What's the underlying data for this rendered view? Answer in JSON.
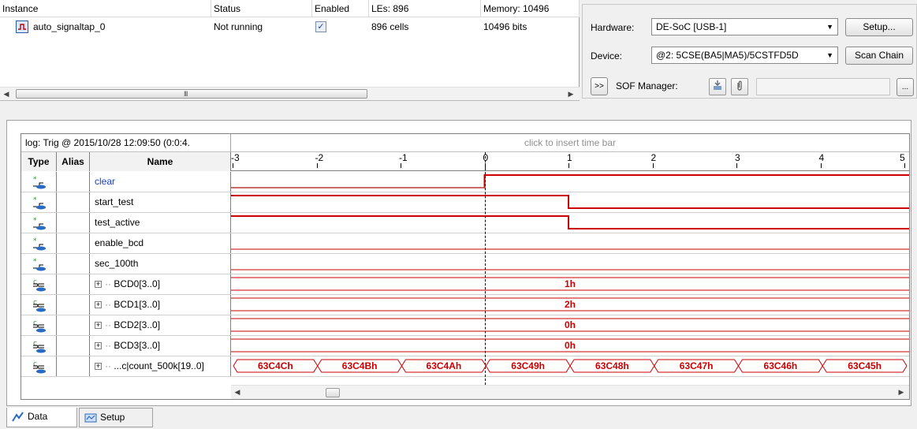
{
  "instance_manager": {
    "columns": [
      "Instance",
      "Status",
      "Enabled",
      "LEs: 896",
      "Memory: 10496"
    ],
    "row": {
      "instance": "auto_signaltap_0",
      "status": "Not running",
      "enabled": true,
      "enabled_mark": "✓",
      "les": "896 cells",
      "memory": "10496 bits"
    },
    "scroll_grip": "III",
    "scroll_left": "◀",
    "scroll_right": "▶"
  },
  "jtag": {
    "hardware_label": "Hardware:",
    "hardware_value": "DE-SoC [USB-1]",
    "setup_button": "Setup...",
    "device_label": "Device:",
    "device_value": "@2: 5CSE(BA5|MA5)/5CSTFD5D",
    "scan_chain_button": "Scan Chain",
    "expand_button": ">>",
    "sof_label": "SOF Manager:",
    "browse_button": "...",
    "dropdown_arrow": "▼"
  },
  "data_panel": {
    "log_label": "log: Trig @ 2015/10/28 12:09:50 (0:0:4.",
    "insert_hint": "click to insert time bar",
    "headers": {
      "type": "Type",
      "alias": "Alias",
      "name": "Name"
    },
    "ticks": [
      "-3",
      "-2",
      "-1",
      "0",
      "1",
      "2",
      "3",
      "4",
      "5"
    ],
    "expand_mark": "+",
    "rows": [
      {
        "name": "clear",
        "kind": "input"
      },
      {
        "name": "start_test",
        "kind": "input"
      },
      {
        "name": "test_active",
        "kind": "input"
      },
      {
        "name": "enable_bcd",
        "kind": "input"
      },
      {
        "name": "sec_100th",
        "kind": "input"
      },
      {
        "name": "BCD0[3..0]",
        "kind": "bus",
        "value": "1h"
      },
      {
        "name": "BCD1[3..0]",
        "kind": "bus",
        "value": "2h"
      },
      {
        "name": "BCD2[3..0]",
        "kind": "bus",
        "value": "0h"
      },
      {
        "name": "BCD3[3..0]",
        "kind": "bus",
        "value": "0h"
      },
      {
        "name": "...c|count_500k[19..0]",
        "kind": "bus",
        "values": [
          "63C4Ch",
          "63C4Bh",
          "63C4Ah",
          "63C49h",
          "63C48h",
          "63C47h",
          "63C46h",
          "63C45h"
        ]
      }
    ],
    "scroll_left": "◀",
    "scroll_right": "▶"
  },
  "tabs": [
    {
      "label": "Data",
      "active": true
    },
    {
      "label": "Setup",
      "active": false
    }
  ],
  "colors": {
    "waveform": "#cc0000",
    "cursor": "#000000",
    "name_highlight": "#1a3fd0"
  },
  "icons": {
    "instance": "signaltap-instance-icon",
    "input_node": "input-node-icon",
    "bus_node": "bus-node-icon",
    "jtag_program": "program-device-icon",
    "attach": "attach-sof-icon"
  }
}
